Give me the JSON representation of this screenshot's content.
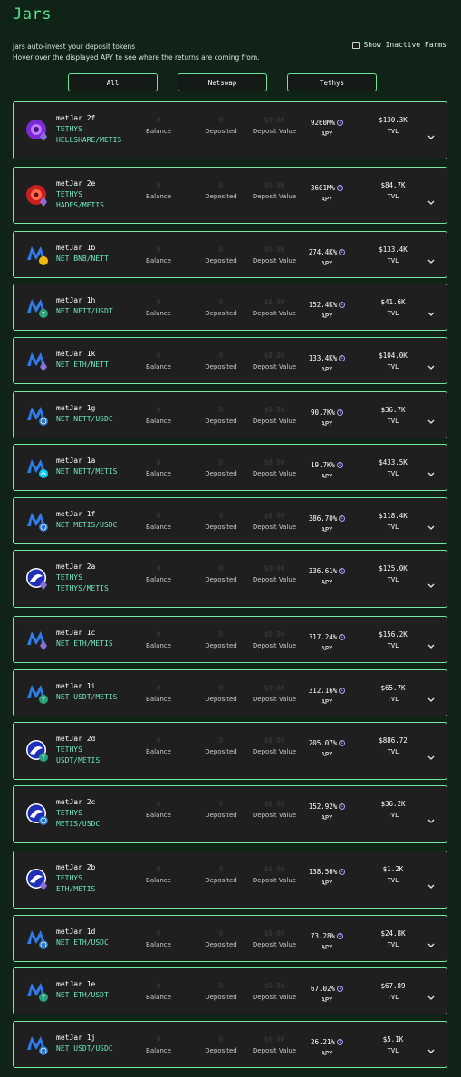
{
  "page": {
    "title": "Jars",
    "intro_line1": "Jars auto-invest your deposit tokens",
    "intro_line2": "Hover over the displayed APY to see where the returns are coming from.",
    "show_inactive_label": "Show Inactive Farms"
  },
  "filters": [
    "All",
    "Netswap",
    "Tethys"
  ],
  "labels": {
    "balance": "Balance",
    "deposited": "Deposited",
    "deposit_value": "Deposit Value",
    "apy": "APY",
    "tvl": "TVL",
    "info_glyph": "i"
  },
  "colors": {
    "accent": "#79e6a2",
    "pair_text": "#6ce9c3",
    "card_bg": "#1f1f1f",
    "page_bg": "#0f2417"
  },
  "jars": [
    {
      "name": "metJar 2f",
      "protocol": "TETHYS",
      "pair": "HELLSHARE/METIS",
      "balance": "0",
      "deposited": "0",
      "deposit_value": "$0.00",
      "apy": "9260M%",
      "tvl": "$130.3K",
      "icon": "tethys-hellshare-icon"
    },
    {
      "name": "metJar 2e",
      "protocol": "TETHYS",
      "pair": "HADES/METIS",
      "balance": "0",
      "deposited": "0",
      "deposit_value": "$0.00",
      "apy": "3601M%",
      "tvl": "$84.7K",
      "icon": "tethys-hades-icon"
    },
    {
      "name": "metJar 1b",
      "protocol": "NET",
      "pair": "BNB/NETT",
      "balance": "0",
      "deposited": "0",
      "deposit_value": "$0.00",
      "apy": "274.4K%",
      "tvl": "$133.4K",
      "icon": "netswap-bnb-icon"
    },
    {
      "name": "metJar 1h",
      "protocol": "NET",
      "pair": "NETT/USDT",
      "balance": "0",
      "deposited": "0",
      "deposit_value": "$0.00",
      "apy": "152.4K%",
      "tvl": "$41.6K",
      "icon": "netswap-usdt-icon"
    },
    {
      "name": "metJar 1k",
      "protocol": "NET",
      "pair": "ETH/NETT",
      "balance": "0",
      "deposited": "0",
      "deposit_value": "$0.00",
      "apy": "133.4K%",
      "tvl": "$104.0K",
      "icon": "netswap-eth-icon"
    },
    {
      "name": "metJar 1g",
      "protocol": "NET",
      "pair": "NETT/USDC",
      "balance": "0",
      "deposited": "0",
      "deposit_value": "$0.00",
      "apy": "90.7K%",
      "tvl": "$36.7K",
      "icon": "netswap-usdc-icon"
    },
    {
      "name": "metJar 1a",
      "protocol": "NET",
      "pair": "NETT/METIS",
      "balance": "0",
      "deposited": "0",
      "deposit_value": "$0.00",
      "apy": "19.7K%",
      "tvl": "$433.5K",
      "icon": "netswap-metis-icon"
    },
    {
      "name": "metJar 1f",
      "protocol": "NET",
      "pair": "METIS/USDC",
      "balance": "0",
      "deposited": "0",
      "deposit_value": "$0.00",
      "apy": "386.70%",
      "tvl": "$118.4K",
      "icon": "netswap-metis-usdc-icon"
    },
    {
      "name": "metJar 2a",
      "protocol": "TETHYS",
      "pair": "TETHYS/METIS",
      "balance": "0",
      "deposited": "0",
      "deposit_value": "$0.00",
      "apy": "336.61%",
      "tvl": "$125.0K",
      "icon": "tethys-metis-icon"
    },
    {
      "name": "metJar 1c",
      "protocol": "NET",
      "pair": "ETH/METIS",
      "balance": "0",
      "deposited": "0",
      "deposit_value": "$0.00",
      "apy": "317.24%",
      "tvl": "$156.2K",
      "icon": "netswap-eth-metis-icon"
    },
    {
      "name": "metJar 1i",
      "protocol": "NET",
      "pair": "USDT/METIS",
      "balance": "0",
      "deposited": "0",
      "deposit_value": "$0.00",
      "apy": "312.16%",
      "tvl": "$65.7K",
      "icon": "netswap-usdt-metis-icon"
    },
    {
      "name": "metJar 2d",
      "protocol": "TETHYS",
      "pair": "USDT/METIS",
      "balance": "0",
      "deposited": "0",
      "deposit_value": "$0.00",
      "apy": "205.07%",
      "tvl": "$886.72",
      "icon": "tethys-usdt-metis-icon"
    },
    {
      "name": "metJar 2c",
      "protocol": "TETHYS",
      "pair": "METIS/USDC",
      "balance": "0",
      "deposited": "0",
      "deposit_value": "$0.00",
      "apy": "152.92%",
      "tvl": "$36.2K",
      "icon": "tethys-metis-usdc-icon"
    },
    {
      "name": "metJar 2b",
      "protocol": "TETHYS",
      "pair": "ETH/METIS",
      "balance": "0",
      "deposited": "0",
      "deposit_value": "$0.00",
      "apy": "138.56%",
      "tvl": "$1.2K",
      "icon": "tethys-eth-metis-icon"
    },
    {
      "name": "metJar 1d",
      "protocol": "NET",
      "pair": "ETH/USDC",
      "balance": "0",
      "deposited": "0",
      "deposit_value": "$0.00",
      "apy": "73.28%",
      "tvl": "$24.8K",
      "icon": "netswap-eth-usdc-icon"
    },
    {
      "name": "metJar 1e",
      "protocol": "NET",
      "pair": "ETH/USDT",
      "balance": "0",
      "deposited": "0",
      "deposit_value": "$0.00",
      "apy": "67.02%",
      "tvl": "$67.89",
      "icon": "netswap-eth-usdt-icon"
    },
    {
      "name": "metJar 1j",
      "protocol": "NET",
      "pair": "USDT/USDC",
      "balance": "0",
      "deposited": "0",
      "deposit_value": "$0.00",
      "apy": "26.21%",
      "tvl": "$5.1K",
      "icon": "netswap-usdt-usdc-icon"
    }
  ]
}
